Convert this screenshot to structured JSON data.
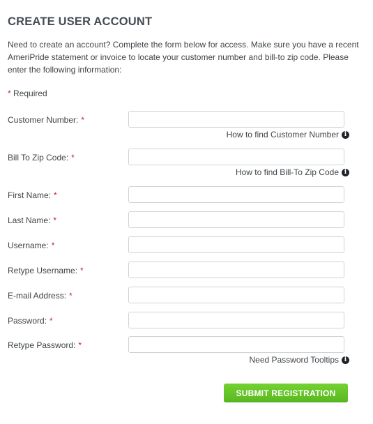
{
  "form": {
    "title": "CREATE USER ACCOUNT",
    "intro": "Need to create an account? Complete the form below for access. Make sure you have a recent AmeriPride statement or invoice to locate your customer number and bill-to zip code. Please enter the following information:",
    "required_star": "*",
    "required_text": "Required",
    "fields": {
      "customer_number": {
        "label": "Customer Number:",
        "value": "",
        "placeholder": ""
      },
      "bill_to_zip": {
        "label": "Bill To Zip Code:",
        "value": "",
        "placeholder": ""
      },
      "first_name": {
        "label": "First Name:",
        "value": "",
        "placeholder": ""
      },
      "last_name": {
        "label": "Last Name:",
        "value": "",
        "placeholder": ""
      },
      "username": {
        "label": "Username:",
        "value": "",
        "placeholder": ""
      },
      "retype_username": {
        "label": "Retype Username:",
        "value": "",
        "placeholder": ""
      },
      "email": {
        "label": "E-mail Address:",
        "value": "",
        "placeholder": ""
      },
      "password": {
        "label": "Password:",
        "value": "",
        "placeholder": ""
      },
      "retype_password": {
        "label": "Retype Password:",
        "value": "",
        "placeholder": ""
      }
    },
    "help": {
      "customer_number": "How to find Customer Number",
      "bill_to_zip": "How to find Bill-To Zip Code",
      "password": "Need Password Tooltips"
    },
    "info_icon": "info-icon",
    "info_glyph": "i",
    "submit_label": "SUBMIT REGISTRATION"
  },
  "colors": {
    "required_star": "#c4262e",
    "submit_button": "#62c226",
    "title": "#444c55",
    "input_border": "#cfd3d6"
  }
}
